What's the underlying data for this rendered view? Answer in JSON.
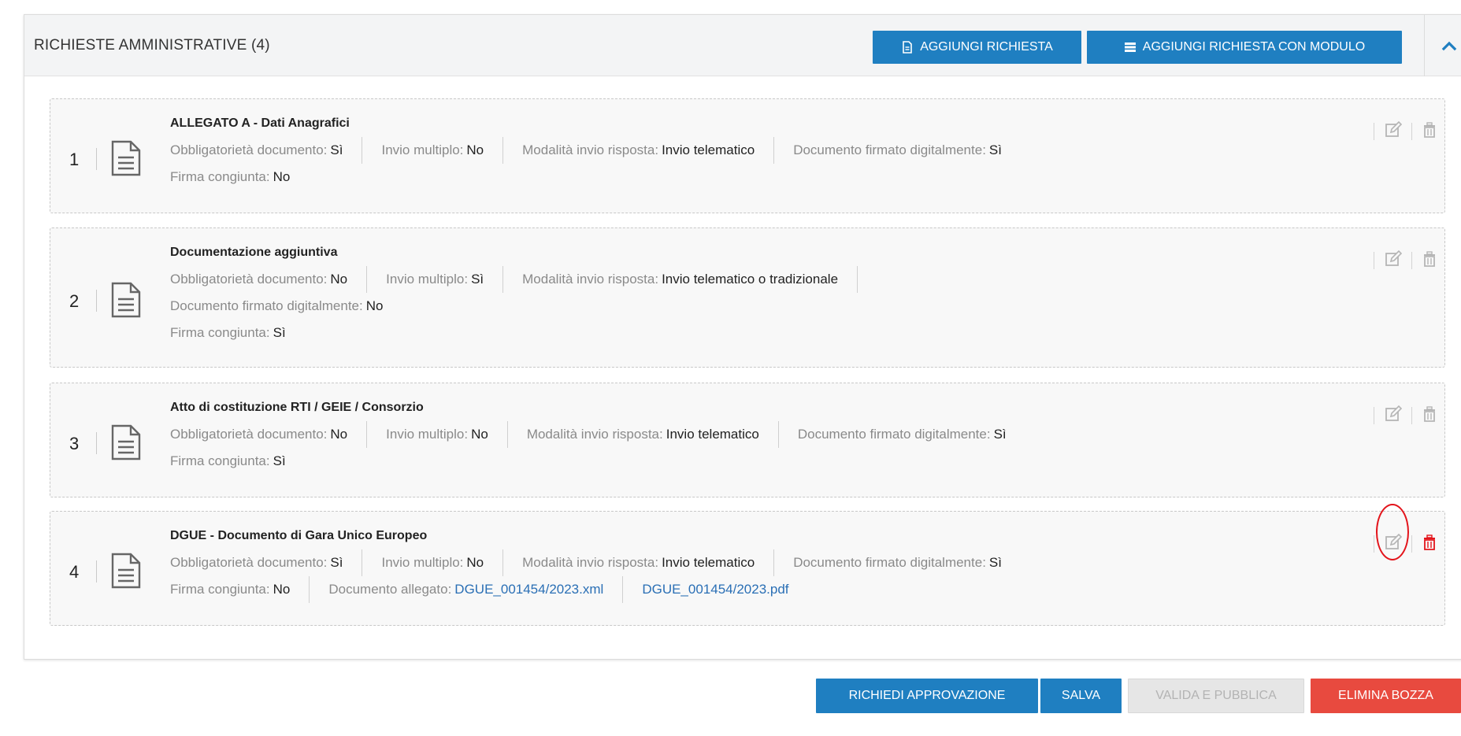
{
  "panel": {
    "title": "RICHIESTE AMMINISTRATIVE (4)",
    "buttons": {
      "add_request": "AGGIUNGI RICHIESTA",
      "add_request_form": "AGGIUNGI RICHIESTA CON MODULO"
    }
  },
  "labels": {
    "mandatory": "Obbligatorietà documento:",
    "multiple": "Invio multiplo:",
    "mode": "Modalità invio risposta:",
    "signed": "Documento firmato digitalmente:",
    "joint": "Firma congiunta:",
    "attached": "Documento allegato:"
  },
  "requests": [
    {
      "number": "1",
      "title": "ALLEGATO A - Dati Anagrafici",
      "mandatory": "Sì",
      "multiple": "No",
      "mode": "Invio telematico",
      "signed": "Sì",
      "joint": "No"
    },
    {
      "number": "2",
      "title": "Documentazione aggiuntiva",
      "mandatory": "No",
      "multiple": "Sì",
      "mode": "Invio telematico o tradizionale",
      "signed": "No",
      "joint": "Sì"
    },
    {
      "number": "3",
      "title": "Atto di costituzione RTI / GEIE / Consorzio",
      "mandatory": "No",
      "multiple": "No",
      "mode": "Invio telematico",
      "signed": "Sì",
      "joint": "Sì"
    },
    {
      "number": "4",
      "title": "DGUE - Documento di Gara Unico Europeo",
      "mandatory": "Sì",
      "multiple": "No",
      "mode": "Invio telematico",
      "signed": "Sì",
      "joint": "No",
      "attachments": [
        "DGUE_001454/2023.xml",
        "DGUE_001454/2023.pdf"
      ]
    }
  ],
  "footer": {
    "request_approval": "RICHIEDI APPROVAZIONE",
    "save": "SALVA",
    "validate_publish": "VALIDA E PUBBLICA",
    "delete_draft": "ELIMINA BOZZA"
  },
  "icons": {
    "add_request": "document-icon",
    "add_request_form": "list-icon",
    "collapse": "chevron-up-icon",
    "request": "document-lines-icon",
    "edit": "edit-icon",
    "delete": "trash-icon"
  },
  "colors": {
    "primary": "#1f7fc1",
    "danger": "#e84a3f",
    "highlight": "#e3141b",
    "link": "#2a6fb5"
  }
}
